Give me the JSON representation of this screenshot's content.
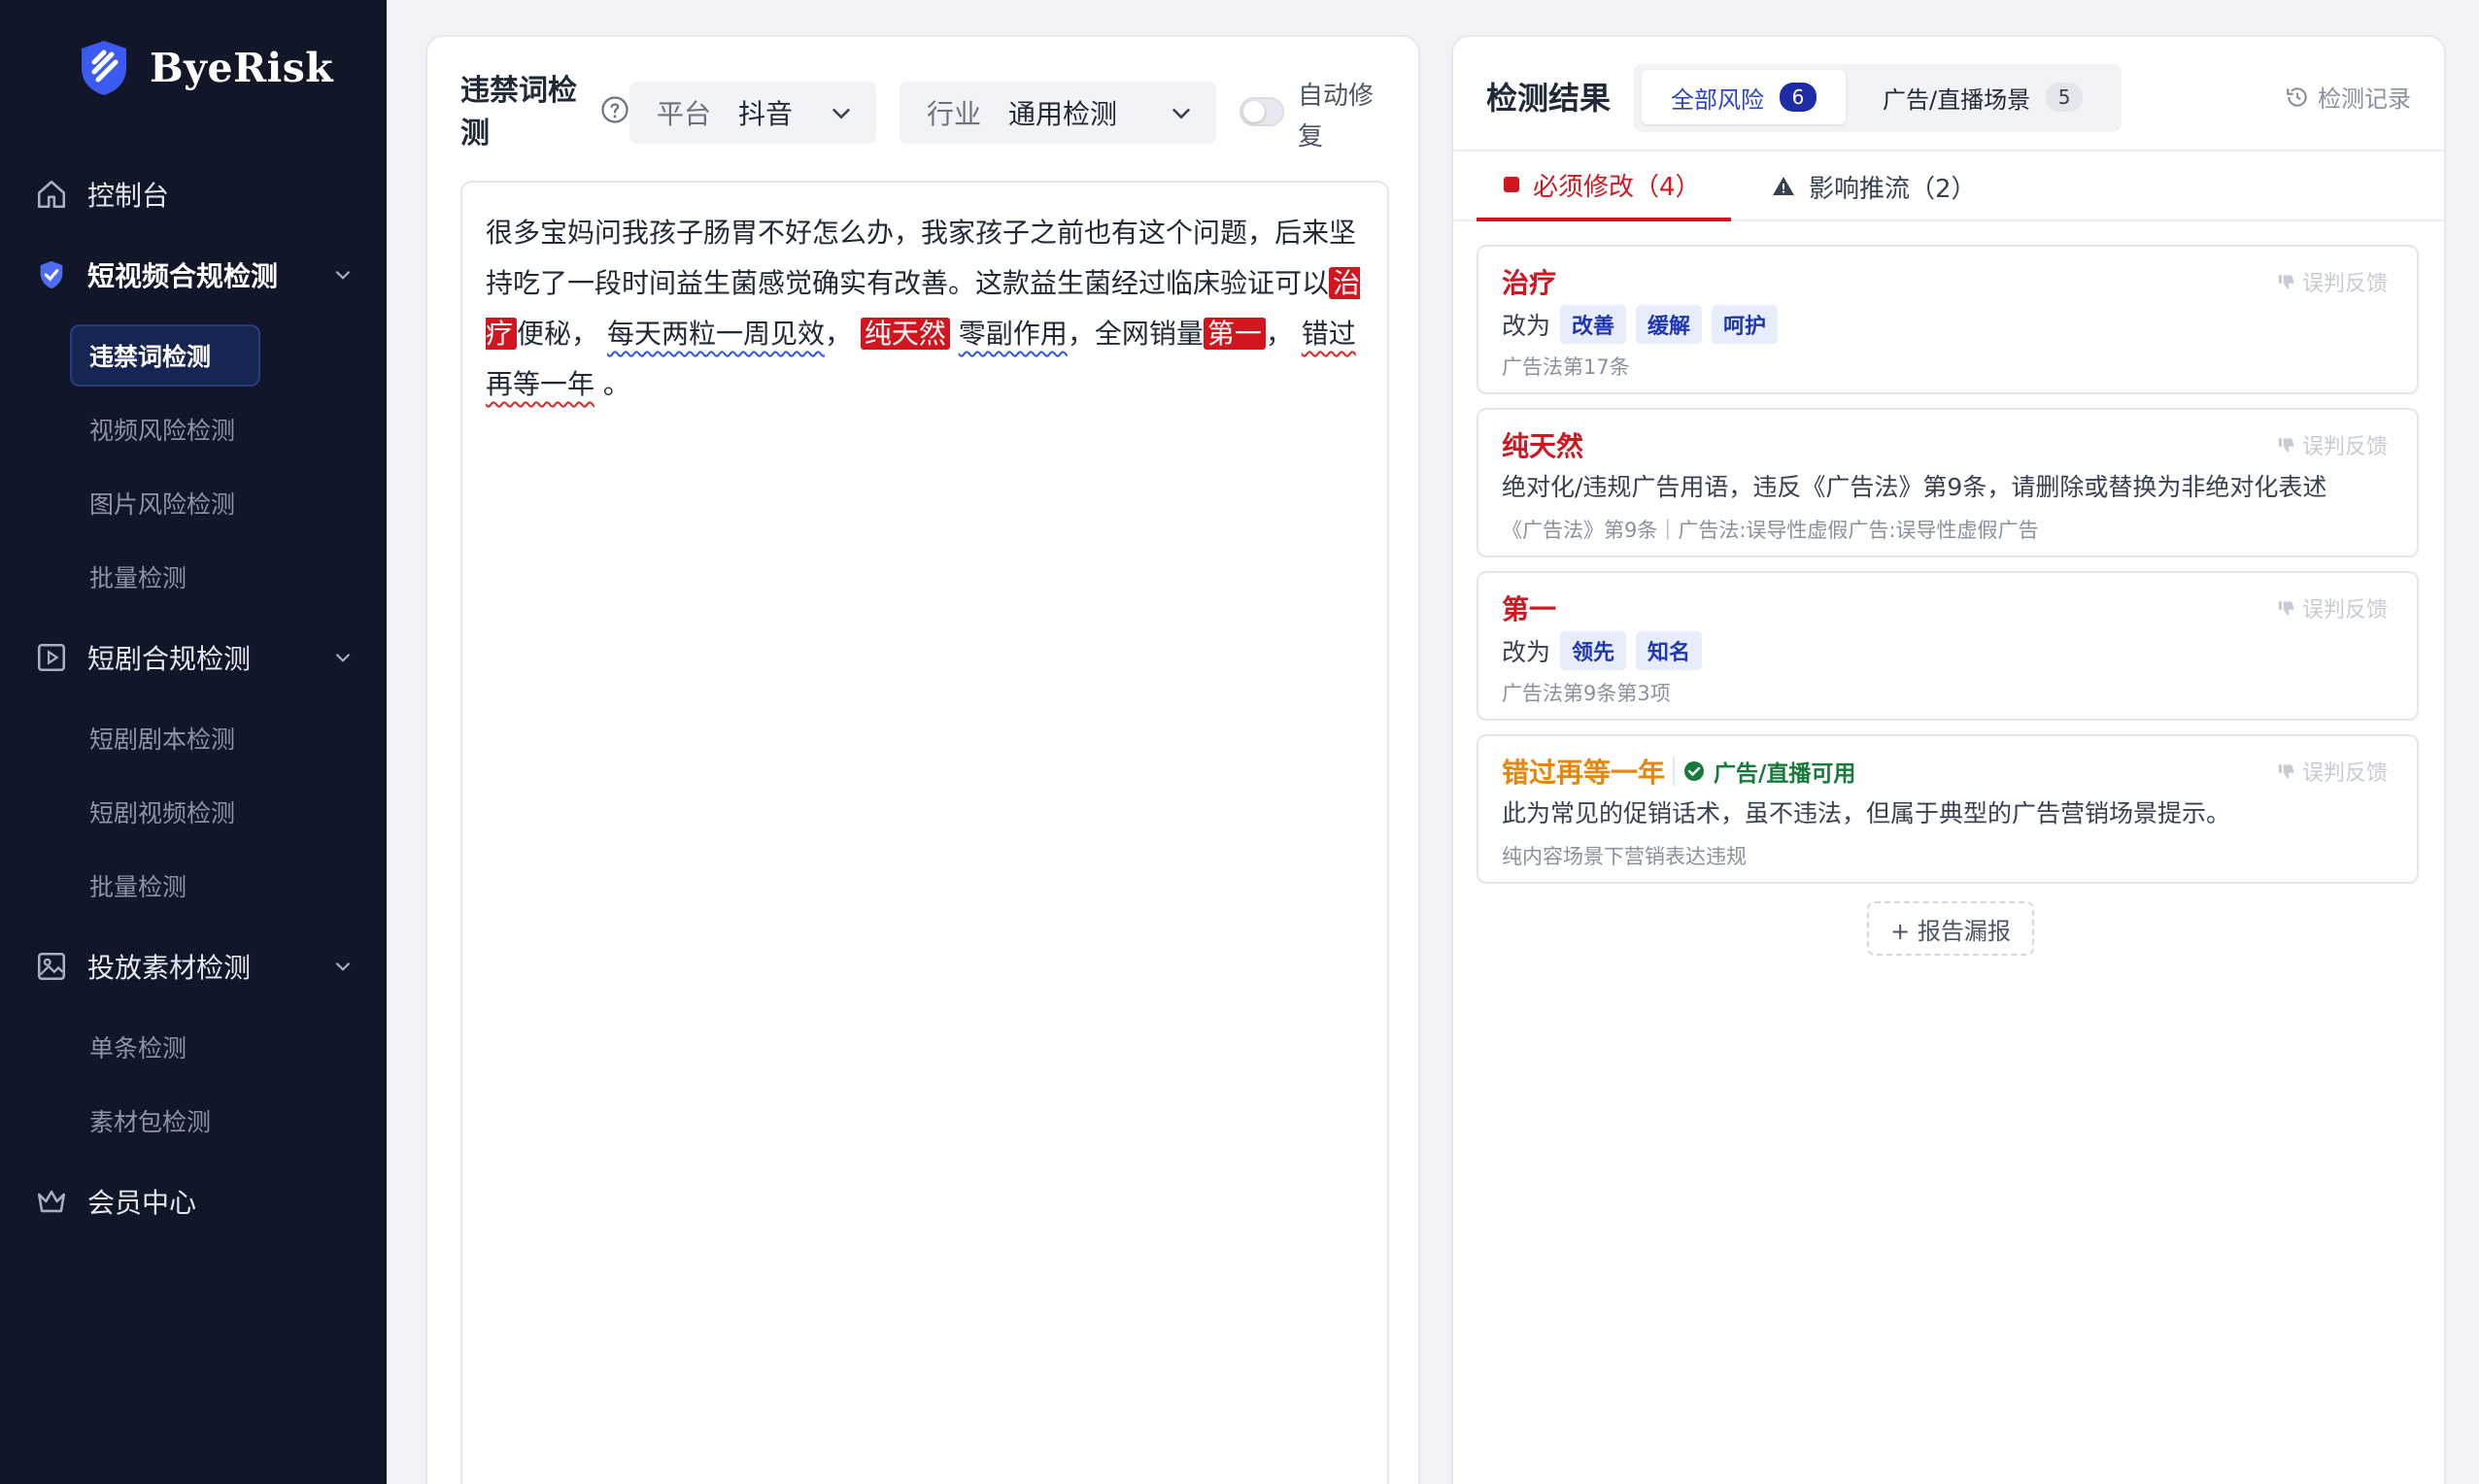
{
  "app": {
    "name": "ByeRisk"
  },
  "sidebar": {
    "top_items": [
      {
        "label": "控制台"
      },
      {
        "label": "短视频合规检测"
      },
      {
        "label": "短剧合规检测"
      },
      {
        "label": "投放素材检测"
      },
      {
        "label": "会员中心"
      }
    ],
    "sub_items": [
      {
        "label": "违禁词检测"
      },
      {
        "label": "视频风险检测"
      },
      {
        "label": "图片风险检测"
      },
      {
        "label": "批量检测"
      },
      {
        "label": "短剧剧本检测"
      },
      {
        "label": "短剧视频检测"
      },
      {
        "label": "批量检测"
      },
      {
        "label": "单条检测"
      },
      {
        "label": "素材包检测"
      }
    ]
  },
  "editor": {
    "title": "违禁词检测",
    "platform": {
      "label": "平台",
      "value": "抖音"
    },
    "industry": {
      "label": "行业",
      "value": "通用检测"
    },
    "auto_fix_label": "自动修复",
    "auto_fix_on": false,
    "text": {
      "p1": "很多宝妈问我孩子肠胃不好怎么办，我家孩子之前也有这个问题，后来坚持吃了一段时间益生菌感觉确实有改善。这款益生菌经过临床验证可以",
      "hl_zhiliao": "治疗",
      "p2": "便秘，",
      "wave_meitian": "每天两粒一周见效",
      "p3": "，",
      "hl_chuntianran": "纯天然",
      "wave_lingfuzuoyong": "零副作用",
      "p4": "，全网销量",
      "hl_diyi": "第一",
      "p5": "，",
      "wave_cuoguo": "错过再等一年",
      "p6": "。"
    }
  },
  "results": {
    "title": "检测结果",
    "seg_all": {
      "label": "全部风险",
      "count": "6"
    },
    "seg_ad": {
      "label": "广告/直播场景",
      "count": "5"
    },
    "history_label": "检测记录",
    "tab_must": "必须修改（4）",
    "tab_affect": "影响推流（2）",
    "feedback_label": "误判反馈",
    "items": [
      {
        "word": "治疗",
        "prefix": "改为",
        "chips": [
          "改善",
          "缓解",
          "呵护"
        ],
        "source": "广告法第17条"
      },
      {
        "word": "纯天然",
        "desc": "绝对化/违规广告用语，违反《广告法》第9条，请删除或替换为非绝对化表述",
        "source": "《广告法》第9条｜广告法:误导性虚假广告:误导性虚假广告"
      },
      {
        "word": "第一",
        "prefix": "改为",
        "chips": [
          "领先",
          "知名"
        ],
        "source": "广告法第9条第3项"
      },
      {
        "word": "错过再等一年",
        "tag": "广告/直播可用",
        "desc": "此为常见的促销话术，虽不违法，但属于典型的广告营销场景提示。",
        "source": "纯内容场景下营销表达违规"
      }
    ],
    "report_label": "+ 报告漏报"
  },
  "colors": {
    "sidebar_bg": "#111729",
    "accent_red": "#d1161f",
    "accent_blue": "#2c43c9",
    "orange": "#e8850b",
    "green": "#167a3a"
  }
}
